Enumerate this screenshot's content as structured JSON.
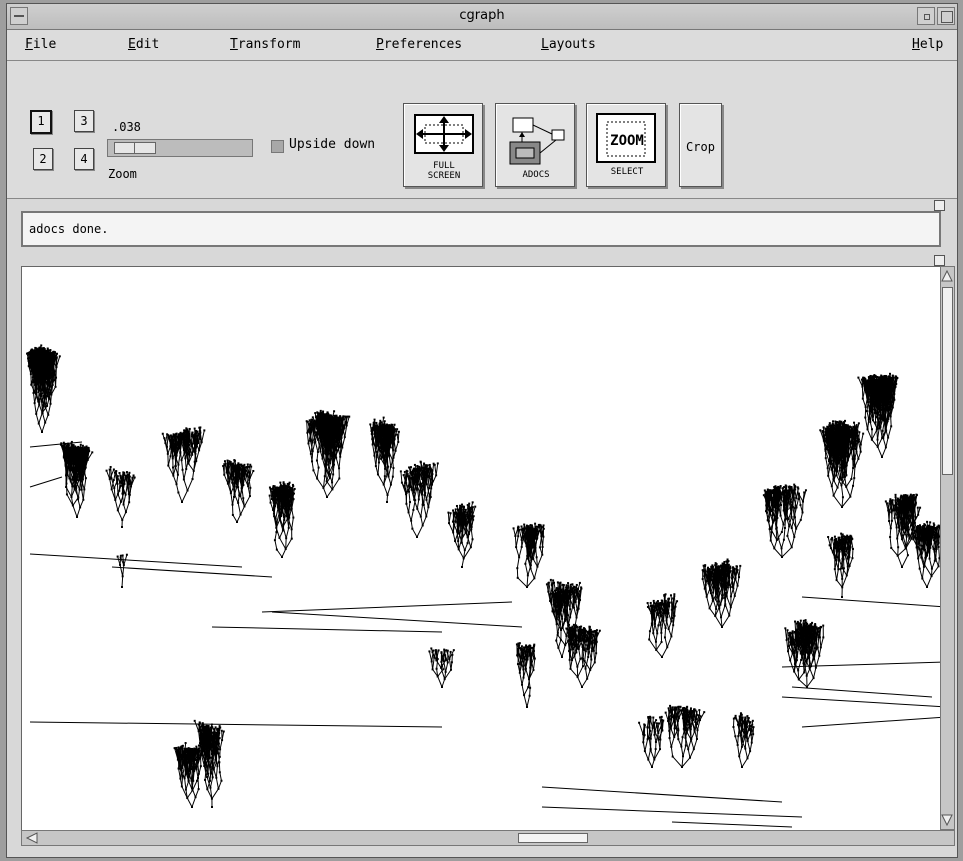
{
  "window": {
    "title": "cgraph"
  },
  "menubar": {
    "items": [
      {
        "mnemonic": "F",
        "rest": "ile"
      },
      {
        "mnemonic": "E",
        "rest": "dit"
      },
      {
        "mnemonic": "T",
        "rest": "ransform"
      },
      {
        "mnemonic": "P",
        "rest": "references"
      },
      {
        "mnemonic": "L",
        "rest": "ayouts"
      },
      {
        "mnemonic": "H",
        "rest": "elp"
      }
    ]
  },
  "toolbar": {
    "panes": [
      "1",
      "2",
      "3",
      "4"
    ],
    "active_pane": "1",
    "zoom_value": ".038",
    "zoom_label": "Zoom",
    "upside_down_label": "Upside down",
    "upside_down_checked": false,
    "full_screen_label_1": "FULL",
    "full_screen_label_2": "SCREEN",
    "adocs_label": "ADOCS",
    "zoom_icon_text": "ZOOM",
    "select_label": "SELECT",
    "crop_label": "Crop"
  },
  "status": {
    "message": "adocs done."
  },
  "icons": {
    "window_menu": "window-menu-icon",
    "minimize": "minimize-icon",
    "maximize": "maximize-icon",
    "scroll_up": "arrow-up-icon",
    "scroll_down": "arrow-down-icon",
    "scroll_left": "arrow-left-icon"
  }
}
